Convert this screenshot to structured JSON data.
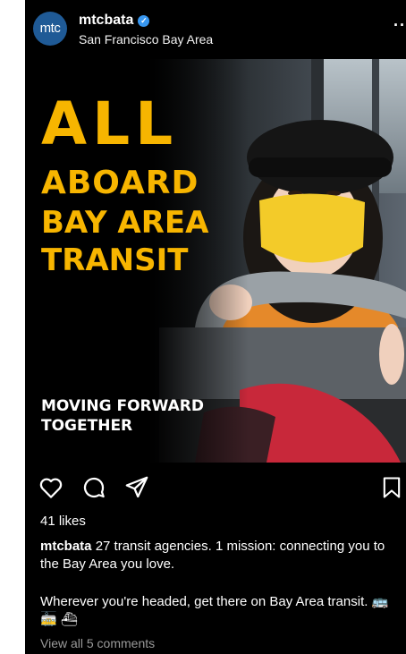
{
  "post": {
    "avatar_text": "mtc",
    "username": "mtcbata",
    "verified_glyph": "✓",
    "location": "San Francisco Bay Area",
    "more_label": "··"
  },
  "image": {
    "headline_lines": [
      "ALL",
      "ABOARD",
      "BAY AREA",
      "TRANSIT"
    ],
    "sub_lines": [
      "MOVING FORWARD",
      "TOGETHER"
    ],
    "accent_color": "#f7b500"
  },
  "actions": {
    "like_icon": "heart-outline-icon",
    "comment_icon": "comment-bubble-icon",
    "share_icon": "paper-plane-icon",
    "save_icon": "bookmark-icon"
  },
  "likes_text": "41 likes",
  "caption": {
    "username": "mtcbata",
    "text": " 27 transit agencies. 1 mission: connecting you to the Bay Area you love.",
    "text2": "Wherever you're headed, get there on Bay Area transit. 🚌 🚋 ⛴"
  },
  "view_comments": "View all 5 comments"
}
